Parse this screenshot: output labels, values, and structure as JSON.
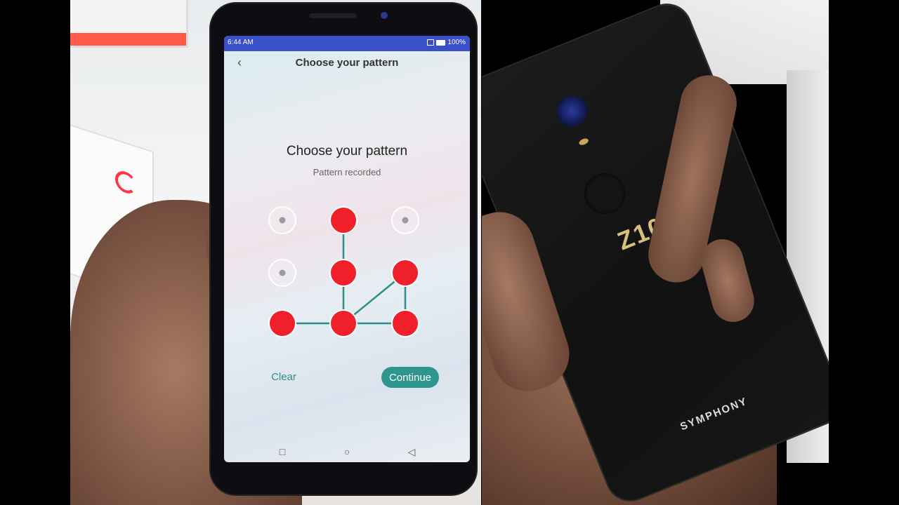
{
  "screen": {
    "status": {
      "time": "6:44 AM",
      "battery": "100%"
    },
    "app_bar": {
      "title": "Choose your pattern"
    },
    "heading": "Choose your pattern",
    "subheading": "Pattern recorded",
    "pattern": {
      "grid": 3,
      "selected_dots": [
        1,
        4,
        5,
        6,
        7,
        8
      ],
      "sequence": [
        1,
        4,
        7,
        5,
        8,
        6
      ],
      "selected_color": "#f0202a",
      "line_color": "#2e8f89"
    },
    "buttons": {
      "clear": "Clear",
      "continue": "Continue"
    },
    "accent": "#2e968f",
    "status_bar_color": "#3950c9"
  },
  "device_back": {
    "model": "Z10",
    "brand": "SYMPHONY"
  }
}
